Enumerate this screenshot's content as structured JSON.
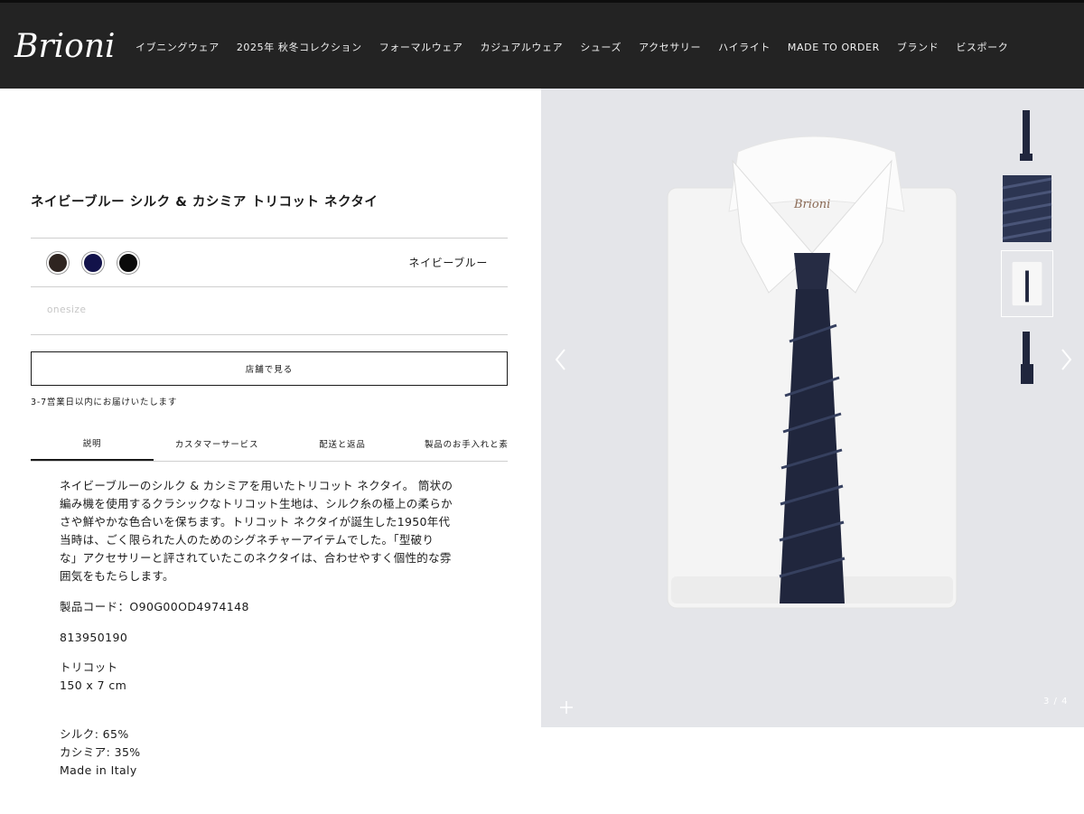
{
  "header": {
    "logo_text": "Brioni",
    "nav": [
      {
        "label": "イブニングウェア"
      },
      {
        "label": "2025年 秋冬コレクション"
      },
      {
        "label": "フォーマルウェア"
      },
      {
        "label": "カジュアルウェア"
      },
      {
        "label": "シューズ"
      },
      {
        "label": "アクセサリー"
      },
      {
        "label": "ハイライト"
      },
      {
        "label": "MADE TO ORDER"
      },
      {
        "label": "ブランド"
      },
      {
        "label": "ビスポーク"
      }
    ]
  },
  "product": {
    "title": "ネイビーブルー シルク & カシミア トリコット ネクタイ",
    "colors": [
      {
        "name": "brown",
        "hex": "#2e2420"
      },
      {
        "name": "navy",
        "hex": "#12124a"
      },
      {
        "name": "black",
        "hex": "#0a0a0a"
      }
    ],
    "selected_color_label": "ネイビーブルー",
    "size_placeholder": "onesize",
    "store_button_label": "店舗で見る",
    "delivery_note": "3-7営業日以内にお届けいたします",
    "tabs": [
      {
        "label": "説明"
      },
      {
        "label": "カスタマーサービス"
      },
      {
        "label": "配送と返品"
      },
      {
        "label": "製品のお手入れと素"
      }
    ],
    "description_lines": [
      "ネイビーブルーのシルク & カシミアを用いたトリコット ネクタイ。 筒状の",
      "編み機を使用するクラシックなトリコット生地は、シルク糸の極上の柔らか",
      "さや鮮やかな色合いを保ちます。トリコット ネクタイが誕生した1950年代",
      "当時は、ごく限られた人のためのシグネチャーアイテムでした。「型破り",
      "な」アクセサリーと評されていたこのネクタイは、合わせやすく個性的な雰",
      "囲気をもたらします。"
    ],
    "product_code": "製品コード：O90G00OD4974148",
    "sku": "813950190",
    "fabric": "トリコット",
    "dimensions": "150 x 7 cm",
    "composition": [
      "シルク: 65%",
      "カシミア: 35%"
    ],
    "origin": "Made in Italy"
  },
  "gallery": {
    "counter": "3 / 4",
    "shirt_logo": "Brioni",
    "accent": {
      "shirt": "#f7f7f7",
      "tie": "#1f2438",
      "bg": "#e4e5e9"
    }
  }
}
